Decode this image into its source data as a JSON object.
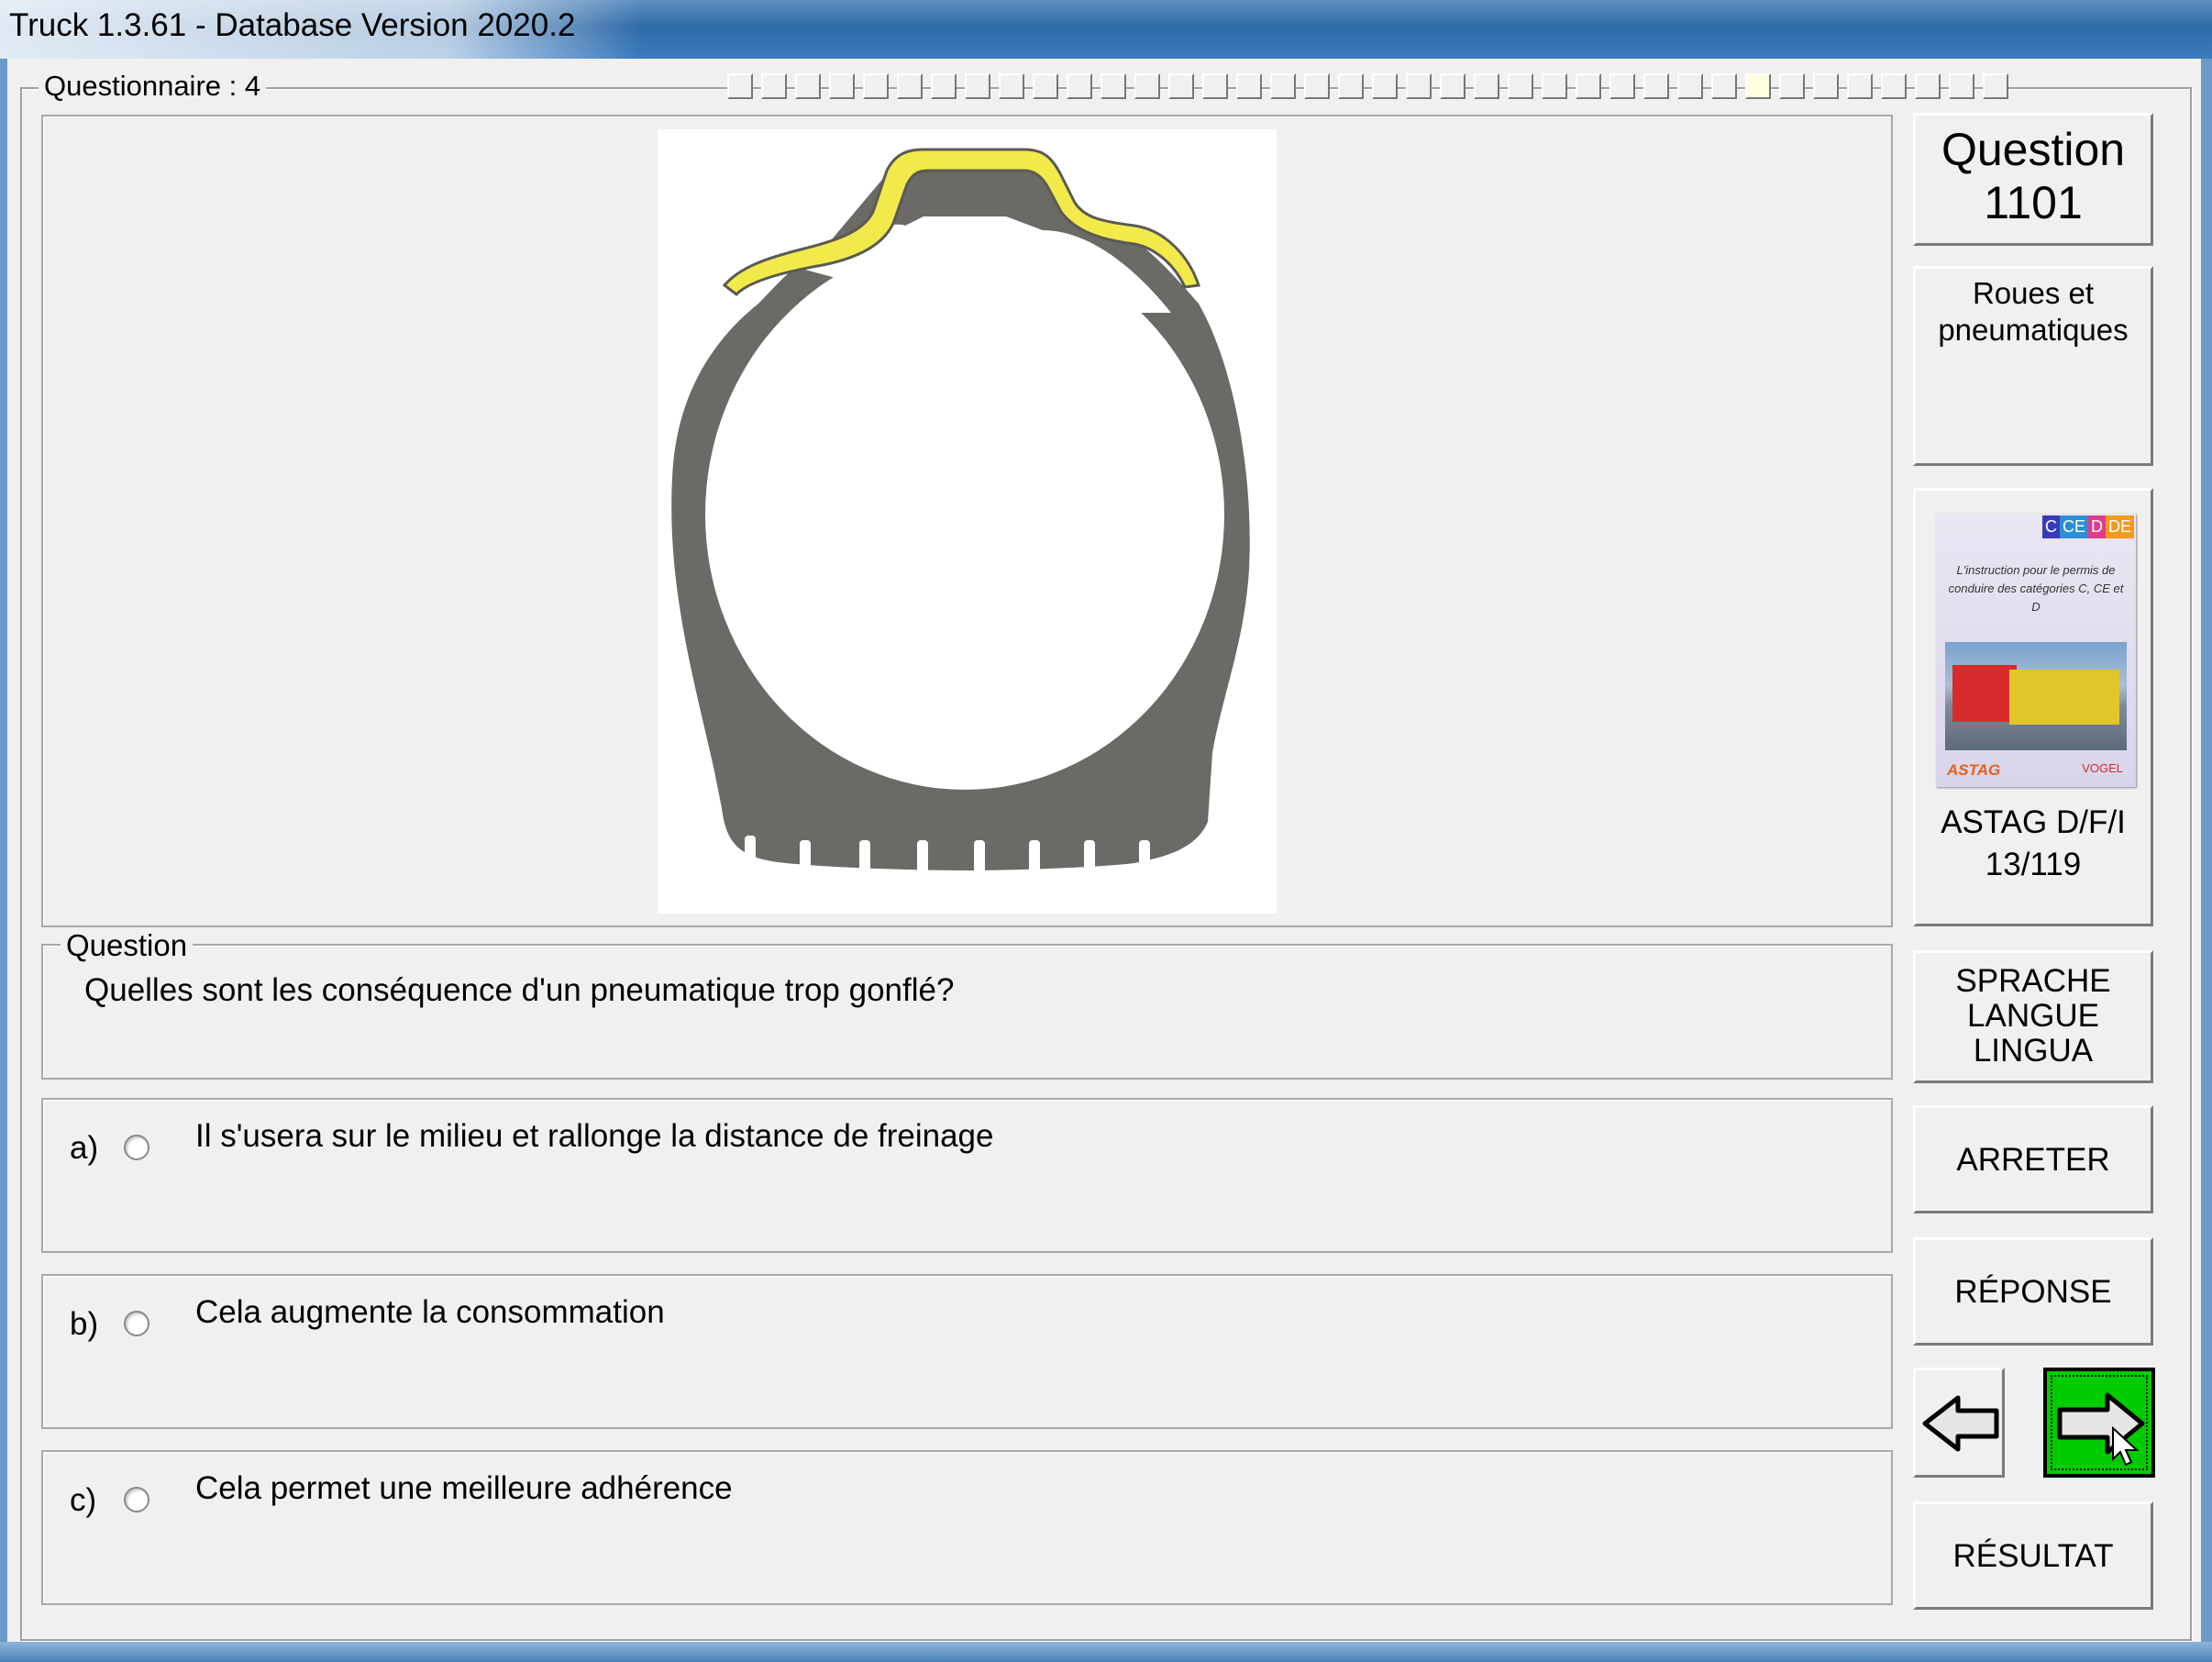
{
  "window": {
    "title": "Truck 1.3.61 - Database Version 2020.2"
  },
  "questionnaire": {
    "label": "Questionnaire : 4",
    "segments_total": 38,
    "current_segment": 31
  },
  "question": {
    "group_label": "Question",
    "text": "Quelles sont les conséquence d'un pneumatique trop gonflé?"
  },
  "answers": [
    {
      "letter": "a)",
      "text": "Il s'usera sur le milieu et rallonge la distance de freinage",
      "selected": false
    },
    {
      "letter": "b)",
      "text": "Cela augmente la consommation",
      "selected": false
    },
    {
      "letter": "c)",
      "text": "Cela permet une meilleure adhérence",
      "selected": false
    }
  ],
  "side": {
    "question_label": "Question",
    "question_number": "1101",
    "category": "Roues et pneumatiques",
    "book": {
      "badge": [
        "C",
        "CE",
        "D",
        "DE"
      ],
      "cover_text": "L'instruction pour le permis de conduire des catégories C, CE et D",
      "logo_left": "ASTAG",
      "logo_right": "VOGEL"
    },
    "source_line1": "ASTAG D/F/I",
    "source_line2": "13/119",
    "language_button": [
      "SPRACHE",
      "LANGUE",
      "LINGUA"
    ],
    "stop_button": "ARRETER",
    "answer_button": "RÉPONSE",
    "result_button": "RÉSULTAT"
  },
  "colors": {
    "titlebar": "#2f6aa8",
    "tire": "#6b6a66",
    "tread_highlight": "#f2ea4a",
    "next_button": "#00cc00"
  },
  "icons": {
    "previous": "arrow-left-icon",
    "next": "arrow-right-icon"
  }
}
